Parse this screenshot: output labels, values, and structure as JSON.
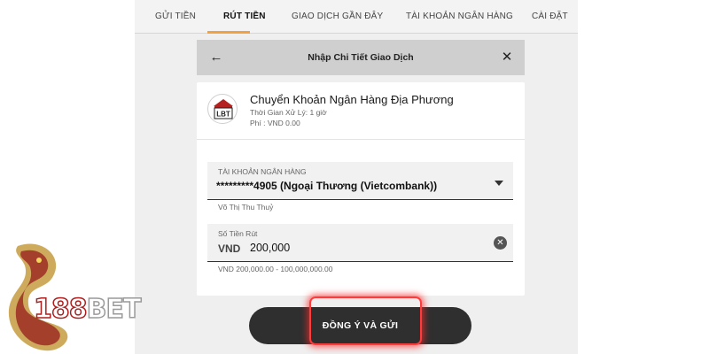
{
  "nav": {
    "tabs": [
      {
        "label": "GỬI TIỀN",
        "active": false
      },
      {
        "label": "RÚT TIỀN",
        "active": true
      },
      {
        "label": "GIAO DỊCH GẦN ĐÂY",
        "active": false
      },
      {
        "label": "TÀI KHOẢN NGÂN HÀNG",
        "active": false
      },
      {
        "label": "CÀI ĐẶT",
        "active": false
      }
    ],
    "accent_color": "#f2a142"
  },
  "modal": {
    "title": "Nhập Chi Tiết Giao Dịch",
    "back_icon": "arrow-left-icon",
    "close_icon": "close-icon"
  },
  "bank": {
    "logo_text": "LBT",
    "name": "Chuyển Khoản Ngân Hàng Địa Phương",
    "processing_time": "Thời Gian Xử Lý: 1 giờ",
    "fee": "Phí : VND 0.00"
  },
  "account": {
    "label": "TÀI KHOẢN NGÂN HÀNG",
    "value": "*********4905 (Ngoại Thương (Vietcombank))",
    "holder": "Võ Thị Thu Thuỷ"
  },
  "amount": {
    "label": "Số Tiền Rút",
    "currency": "VND",
    "value": "200,000",
    "range": "VND 200,000.00 - 100,000,000.00"
  },
  "submit": {
    "label": "ĐỒNG Ý VÀ GỬI",
    "highlight_color": "#ff3b3b"
  },
  "brand": {
    "number": "188",
    "word": "BET"
  }
}
